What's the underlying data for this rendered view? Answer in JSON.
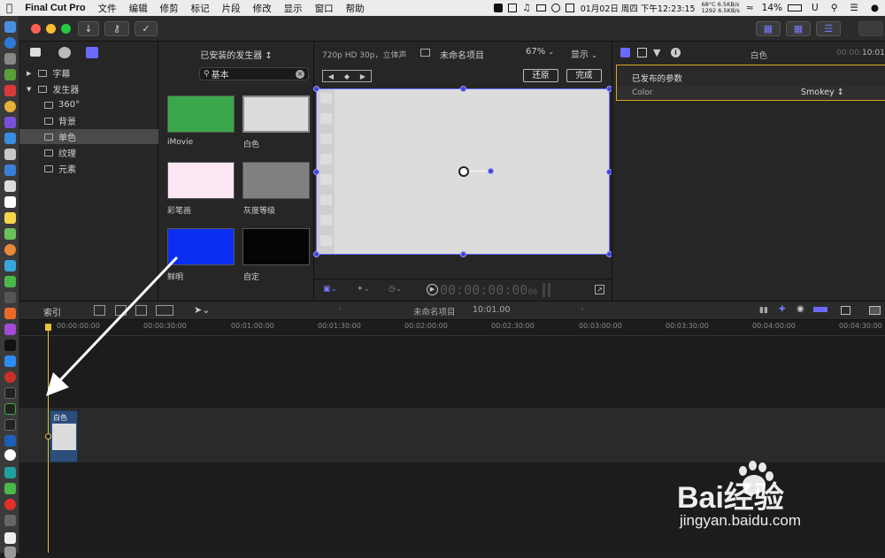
{
  "menubar": {
    "app_name": "Final Cut Pro",
    "menus": [
      "文件",
      "编辑",
      "修剪",
      "标记",
      "片段",
      "修改",
      "显示",
      "窗口",
      "帮助"
    ],
    "temp": "68°C",
    "fan": "1292",
    "net_up": "6.5KB/s",
    "net_down": "6.5KB/s",
    "datetime": "01月02日 周四 下午12:23:15",
    "battery": "14%"
  },
  "library": {
    "items": [
      {
        "label": "字幕"
      },
      {
        "label": "发生器"
      },
      {
        "label": "360°"
      },
      {
        "label": "背景"
      },
      {
        "label": "单色"
      },
      {
        "label": "纹理"
      },
      {
        "label": "元素"
      }
    ]
  },
  "browser": {
    "title": "已安装的发生器",
    "search_value": "基本",
    "swatches": [
      {
        "label": "iMovie",
        "color": "#3aa84a"
      },
      {
        "label": "白色",
        "color": "#dcdcdc"
      },
      {
        "label": "彩笔画",
        "color": "#fde6f4"
      },
      {
        "label": "灰度等级",
        "color": "#808080"
      },
      {
        "label": "鲜明",
        "color": "#0a2ff0"
      },
      {
        "label": "自定",
        "color": "#050505"
      }
    ]
  },
  "viewer": {
    "format": "720p HD 30p，立体声",
    "project_name": "未命名项目",
    "zoom": "67%",
    "display_menu": "显示",
    "reset_button": "还原",
    "done_button": "完成",
    "timecode": "00:00:00:00",
    "timecode_frames": "00"
  },
  "inspector": {
    "title": "白色",
    "duration": "10:01",
    "section": "已发布的参数",
    "param_name": "Color",
    "param_value": "Smokey"
  },
  "timeline": {
    "index_label": "索引",
    "project_name": "未命名项目",
    "duration": "10:01.00",
    "ruler": [
      "00:00:00:00",
      "00:00:30:00",
      "00:01:00:00",
      "00:01:30:00",
      "00:02:00:00",
      "00:02:30:00",
      "00:03:00:00",
      "00:03:30:00",
      "00:04:00:00",
      "00:04:30:00"
    ],
    "clip_label": "白色"
  },
  "watermark": {
    "brand": "Bai经验",
    "url": "jingyan.baidu.com"
  }
}
